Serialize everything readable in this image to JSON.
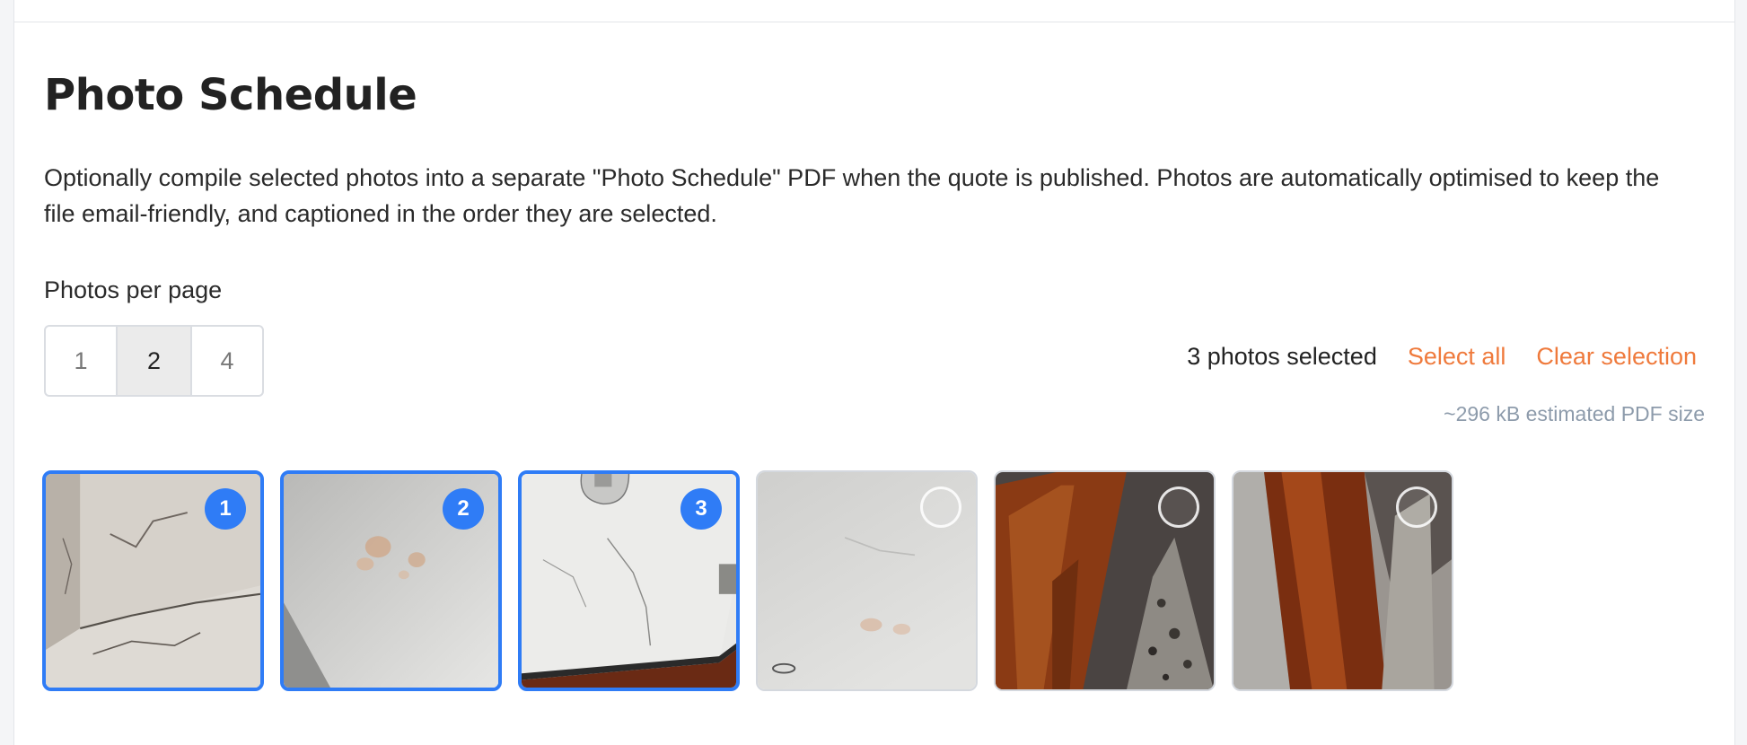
{
  "section": {
    "title": "Photo Schedule",
    "description": "Optionally compile selected photos into a separate \"Photo Schedule\" PDF when the quote is published. Photos are automatically optimised to keep the file email-friendly, and captioned in the order they are selected."
  },
  "photos_per_page": {
    "label": "Photos per page",
    "options": [
      "1",
      "2",
      "4"
    ],
    "selected": "2"
  },
  "selection": {
    "count_text": "3 photos selected",
    "select_all": "Select all",
    "clear": "Clear selection",
    "size_estimate": "~296 kB estimated PDF size"
  },
  "photos": [
    {
      "selected": true,
      "order": "1",
      "subject": "cracked-plaster-corner"
    },
    {
      "selected": true,
      "order": "2",
      "subject": "stained-wall"
    },
    {
      "selected": true,
      "order": "3",
      "subject": "cracked-benchtop-with-tap"
    },
    {
      "selected": false,
      "order": "",
      "subject": "water-stained-ceiling"
    },
    {
      "selected": false,
      "order": "",
      "subject": "timber-bench-and-stone"
    },
    {
      "selected": false,
      "order": "",
      "subject": "timber-floor-and-stone"
    }
  ],
  "colors": {
    "accent": "#2f7cf6",
    "link": "#ef7a3c",
    "muted": "#8d9bab"
  }
}
